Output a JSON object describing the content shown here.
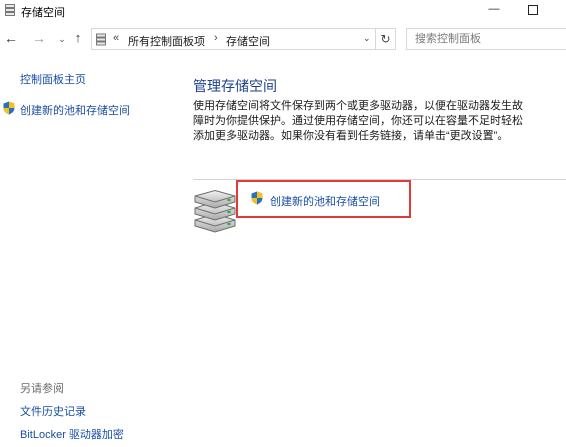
{
  "window": {
    "title": "存储空间",
    "minimize_glyph": "—",
    "maximize_glyph": ""
  },
  "nav": {
    "back_glyph": "←",
    "forward_glyph": "→",
    "recent_glyph": "⌄",
    "up_glyph": "↑"
  },
  "address": {
    "overflow": "«",
    "breadcrumb": [
      "所有控制面板项",
      "存储空间"
    ],
    "separator": "›",
    "dropdown_glyph": "⌄",
    "refresh_glyph": "↻"
  },
  "search": {
    "placeholder": "搜索控制面板"
  },
  "left_pane": {
    "home_link": "控制面板主页",
    "create_link": "创建新的池和存储空间",
    "see_also": "另请参阅",
    "links": [
      "文件历史记录",
      "BitLocker 驱动器加密"
    ]
  },
  "main": {
    "heading": "管理存储空间",
    "description": "使用存储空间将文件保存到两个或更多驱动器，以便在驱动器发生故障时为你提供保护。通过使用存储空间，你还可以在容量不足时轻松添加更多驱动器。如果你没有看到任务链接，请单击“更改设置”。",
    "action_link": "创建新的池和存储空间"
  },
  "colors": {
    "link": "#1a4ea1",
    "heading": "#1e3f8a",
    "highlight_border": "#e23a35",
    "shield_blue": "#2b6fc4",
    "shield_yellow": "#f4c21b"
  },
  "icons": {
    "app": "storage-spaces-icon",
    "shield": "uac-shield-icon",
    "drives": "drive-stack-icon"
  }
}
